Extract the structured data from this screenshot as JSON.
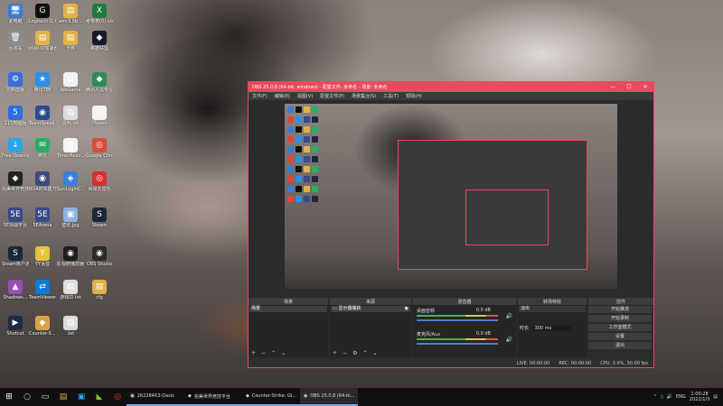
{
  "desktop_icons": [
    {
      "label": "此电脑",
      "color": "#3a7bd5",
      "glyph": "🖥"
    },
    {
      "label": "Logitech G HUB",
      "color": "#111111",
      "glyph": "G"
    },
    {
      "label": "am-3.0b...",
      "color": "#e0b24a",
      "glyph": "▤"
    },
    {
      "label": "考核表(0).xlsx",
      "color": "#1f7a3e",
      "glyph": "X"
    },
    {
      "label": "回收站",
      "color": "#8c8c8c",
      "glyph": "🗑"
    },
    {
      "label": "网易UU加速器",
      "color": "#e0b24a",
      "glyph": "▤"
    },
    {
      "label": "卡券",
      "color": "#e0b24a",
      "glyph": "▤"
    },
    {
      "label": "英雄联盟",
      "color": "#1a1a2e",
      "glyph": "◆"
    },
    {
      "label": "控制面板",
      "color": "#3a6fd8",
      "glyph": "⚙"
    },
    {
      "label": "腾讯TIM",
      "color": "#2b90e8",
      "glyph": "★"
    },
    {
      "label": "WeGame",
      "color": "#f0f0f0",
      "glyph": "G"
    },
    {
      "label": "腾讯人员专业版",
      "color": "#2e8b57",
      "glyph": "◆"
    },
    {
      "label": "115电脑版",
      "color": "#2f6fdd",
      "glyph": "5"
    },
    {
      "label": "TeamSpeak 3",
      "color": "#2a4b8d",
      "glyph": "◉"
    },
    {
      "label": "说明.txt",
      "color": "#dddddd",
      "glyph": "▤"
    },
    {
      "label": "iTunes",
      "color": "#f4f4f4",
      "glyph": "♪"
    },
    {
      "label": "Free Downlo...",
      "color": "#2aa5e8",
      "glyph": "↓"
    },
    {
      "label": "微信",
      "color": "#2aae67",
      "glyph": "✉"
    },
    {
      "label": "TimerReso...",
      "color": "#f4f4f4",
      "glyph": "◷"
    },
    {
      "label": "Google Chrome",
      "color": "#d94a38",
      "glyph": "◎"
    },
    {
      "label": "完美世界竞技平台",
      "color": "#222222",
      "glyph": "◆"
    },
    {
      "label": "BO4的快捷方式",
      "color": "#3c4a7c",
      "glyph": "◉"
    },
    {
      "label": "SunLoginC...",
      "color": "#3d7fd6",
      "glyph": "◈"
    },
    {
      "label": "网易云音乐",
      "color": "#d72f2f",
      "glyph": "◎"
    },
    {
      "label": "5E对战平台",
      "color": "#374a8a",
      "glyph": "5E"
    },
    {
      "label": "5EArena",
      "color": "#374a8a",
      "glyph": "5E"
    },
    {
      "label": "壁纸.jpg",
      "color": "#8fb3e0",
      "glyph": "▣"
    },
    {
      "label": "Steam",
      "color": "#1b2838",
      "glyph": "S"
    },
    {
      "label": "Steam账户游戏",
      "color": "#1b2838",
      "glyph": "S"
    },
    {
      "label": "YY语音",
      "color": "#e8c23a",
      "glyph": "Y"
    },
    {
      "label": "影视剧播放器",
      "color": "#1d1d1d",
      "glyph": "◉"
    },
    {
      "label": "OBS Studio",
      "color": "#2a2a2a",
      "glyph": "◉"
    },
    {
      "label": "Shadows...",
      "color": "#9b4db8",
      "glyph": "▲"
    },
    {
      "label": "TeamViewer",
      "color": "#0e7ad9",
      "glyph": "⇄"
    },
    {
      "label": "游戏ID.txt",
      "color": "#dddddd",
      "glyph": "▤"
    },
    {
      "label": "cfg",
      "color": "#e0b24a",
      "glyph": "▤"
    },
    {
      "label": "Shotcut",
      "color": "#1f2a44",
      "glyph": "▶"
    },
    {
      "label": "Counter-S... Global Off...",
      "color": "#d9a34a",
      "glyph": "◆"
    },
    {
      "label": ".txt",
      "color": "#dddddd",
      "glyph": "▤"
    }
  ],
  "obs": {
    "title": "OBS 25.0.8 (64-bit, windows) - 配置文件: 未命名 - 场景: 未命名",
    "menu": [
      "文件(F)",
      "编辑(E)",
      "视图(V)",
      "配置文件(P)",
      "场景集合(S)",
      "工具(T)",
      "帮助(H)"
    ],
    "window_buttons": [
      "—",
      "☐",
      "✕"
    ],
    "docks": {
      "scenes": {
        "title": "场景",
        "items": [
          "场景"
        ]
      },
      "sources": {
        "title": "来源",
        "items": [
          "显示器捕获"
        ]
      },
      "mixer": {
        "title": "混音器",
        "channels": [
          {
            "name": "桌面音频",
            "value": "0.0 dB"
          },
          {
            "name": "麦克风/Aux",
            "value": "0.0 dB"
          }
        ]
      },
      "transitions": {
        "title": "转场特效",
        "mode": "淡出",
        "duration_label": "时长",
        "duration": "300 ms"
      },
      "controls": {
        "title": "控件",
        "buttons": [
          "开始推流",
          "开始录制",
          "工作室模式",
          "设置",
          "退出"
        ]
      }
    },
    "status": {
      "live": "LIVE: 00:00:00",
      "rec": "REC: 00:00:00",
      "cpu": "CPU: 3.9%, 30.00 fps"
    }
  },
  "taskbar": {
    "apps": [
      {
        "label": "26228463-Oasis",
        "glyph": "▣"
      },
      {
        "label": "完美世界竞技平台",
        "glyph": "◆"
      },
      {
        "label": "Counter-Strike: Gl...",
        "glyph": "◆"
      },
      {
        "label": "OBS 25.0.8 (64-bi...",
        "glyph": "◉"
      }
    ],
    "lang": "ENG",
    "time": "1:00:28",
    "date": "2022/1/3"
  }
}
